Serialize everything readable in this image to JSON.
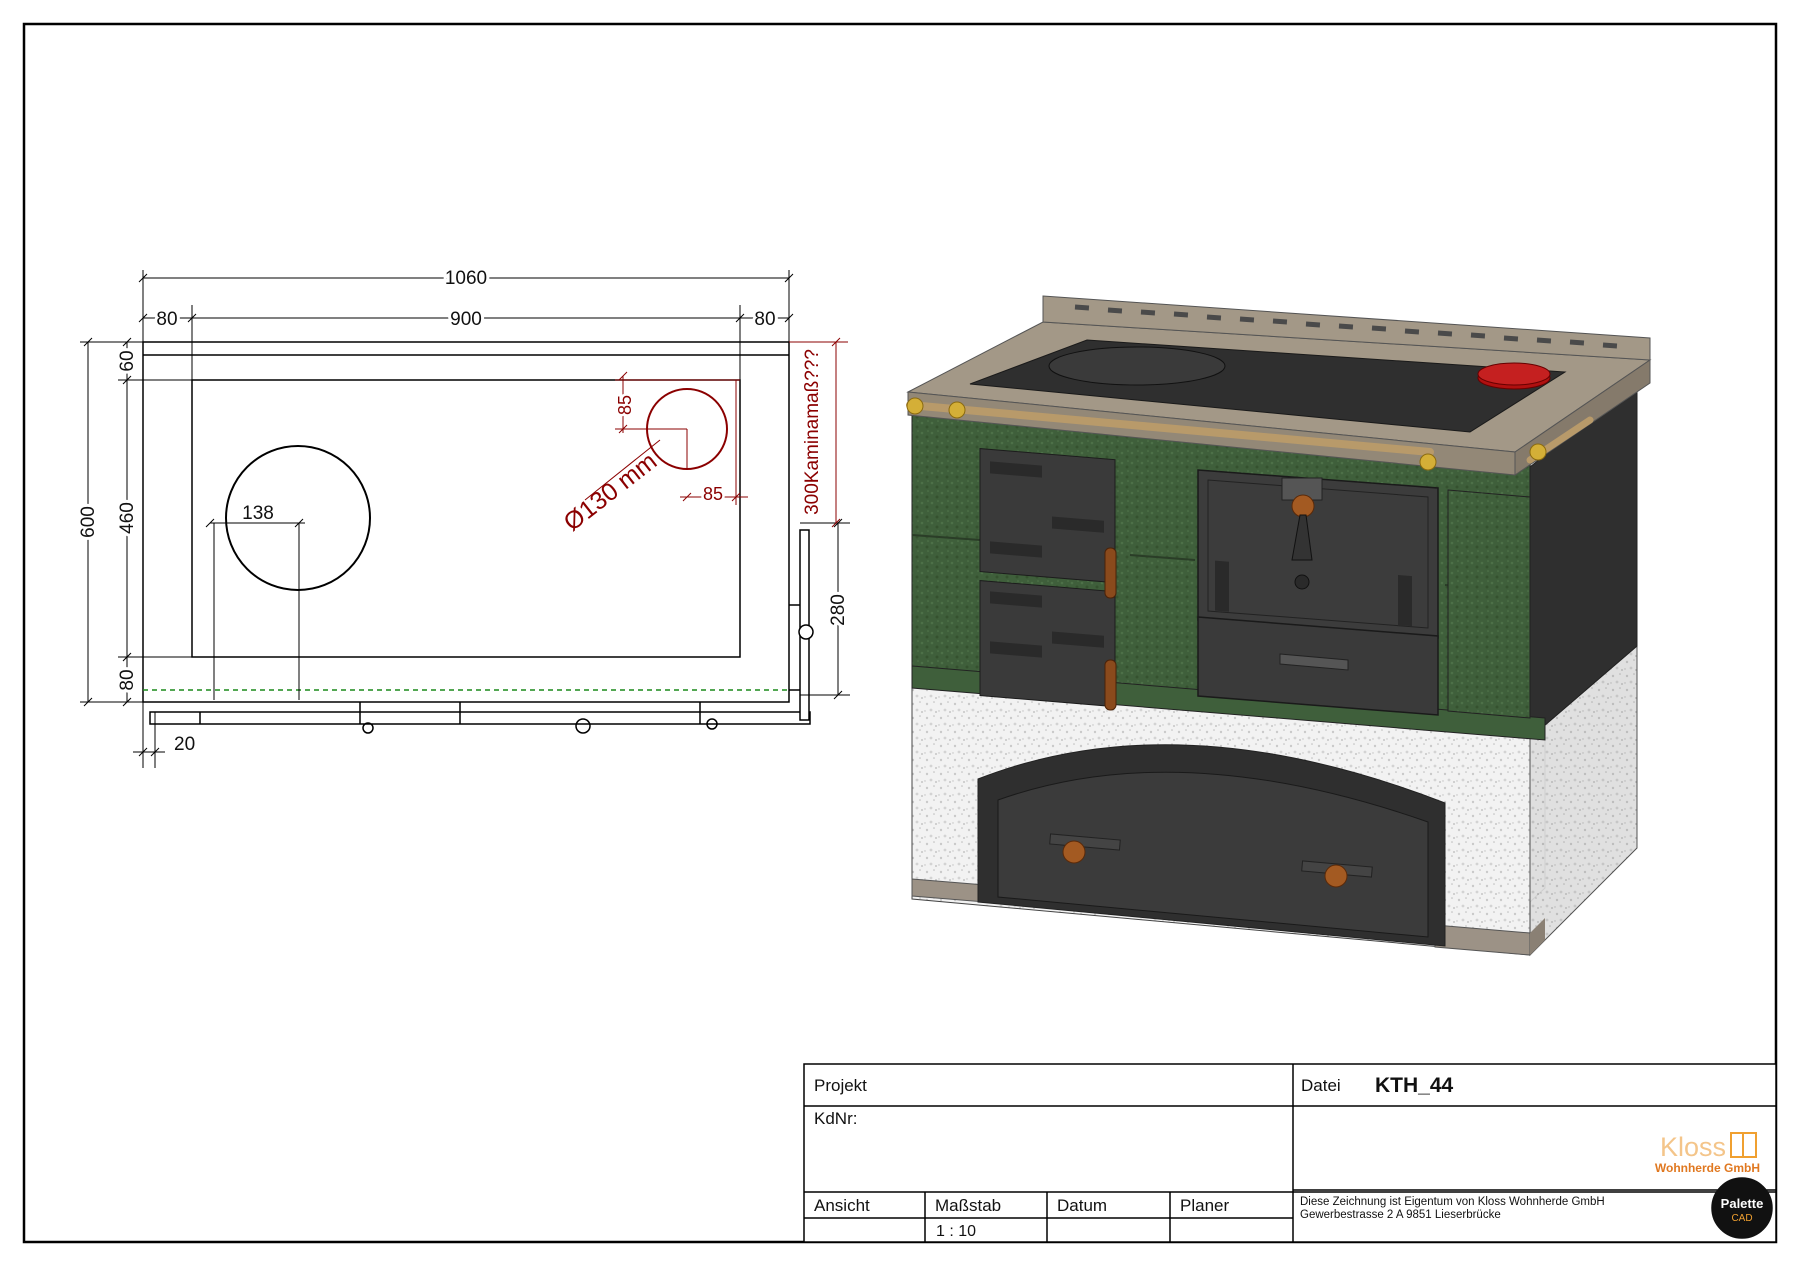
{
  "plan": {
    "dim_total_width": "1060",
    "dim_left": "80",
    "dim_middle": "900",
    "dim_right": "80",
    "dim_depth": "600",
    "dim_60": "60",
    "dim_460": "460",
    "dim_80": "80",
    "dim_20": "20",
    "dim_280": "280",
    "dim_138": "138",
    "dim_85_vertical": "85",
    "dim_85_horizontal": "85",
    "flue_diameter": "Ø130 mm",
    "chimney_note": "300Kaminamaß???"
  },
  "title_block": {
    "projekt_label": "Projekt",
    "kdnr_label": "KdNr:",
    "datei_label": "Datei",
    "datei_value": "KTH_44",
    "ansicht_label": "Ansicht",
    "massstab_label": "Maßstab",
    "massstab_value": "1 : 10",
    "datum_label": "Datum",
    "planer_label": "Planer",
    "logo_brand": "Kloss",
    "logo_subtitle": "Wohnherde GmbH",
    "ownership_line1": "Diese Zeichnung ist Eigentum von Kloss Wohnherde GmbH",
    "ownership_line2": "Gewerbestrasse 2 A 9851 Lieserbrücke",
    "cad_badge_line1": "Palette",
    "cad_badge_line2": "CAD"
  },
  "colors": {
    "dimension_red": "#8b0000",
    "tile_green": "#3e5d3a",
    "iron_dark": "#3c3c3c",
    "stone_frame": "#9a8f80",
    "logo_orange": "#f0a030"
  }
}
